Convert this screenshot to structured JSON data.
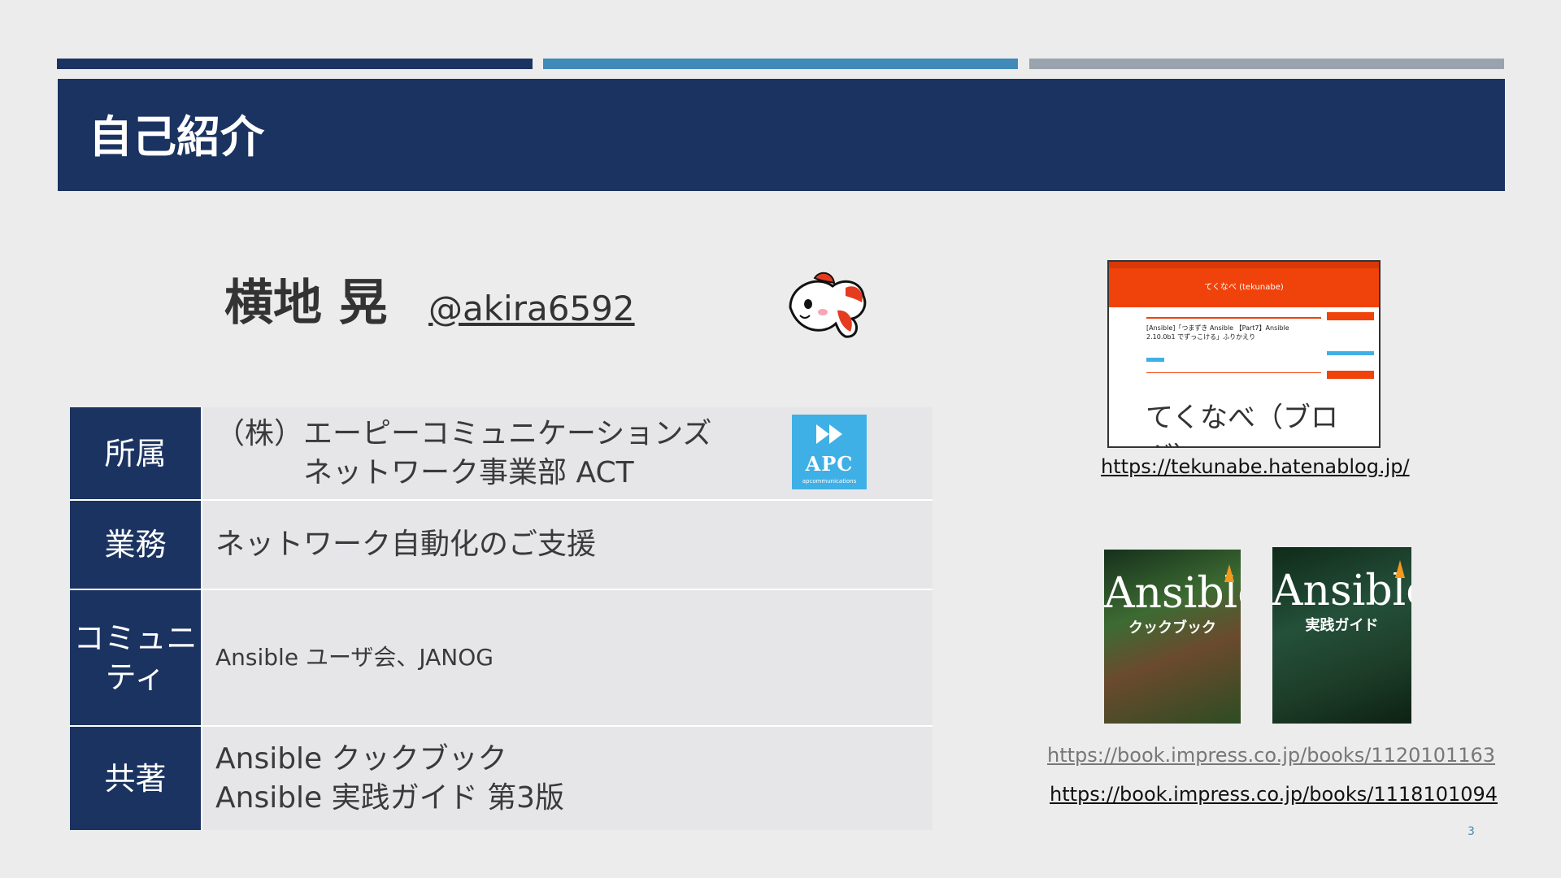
{
  "slide": {
    "title": "自己紹介",
    "page_number": "3"
  },
  "profile": {
    "name": "横地 晃",
    "handle": "@akira6592"
  },
  "table": {
    "rows": [
      {
        "header": "所属",
        "lines": [
          "（株）エーピーコミュニケーションズ",
          "　　　ネットワーク事業部 ACT"
        ]
      },
      {
        "header": "業務",
        "lines": [
          "ネットワーク自動化のご支援"
        ]
      },
      {
        "header": "コミュニティ",
        "header_lines": [
          "コミュニ",
          "ティ"
        ],
        "lines": [
          "Ansible ユーザ会、JANOG"
        ]
      },
      {
        "header": "共著",
        "lines": [
          "Ansible クックブック",
          "Ansible 実践ガイド 第3版"
        ]
      }
    ]
  },
  "apc_logo": {
    "text": "APC",
    "sub": "apcommunications",
    "color": "#3fb0e5"
  },
  "blog": {
    "site": "てくなべ (tekunabe)",
    "post_title": "[Ansible]「つまずき Ansible 【Part7】Ansible 2.10.0b1 でずっこける」ふりかえり",
    "caption": "てくなべ（ブログ）",
    "url": "https://tekunabe.hatenablog.jp/"
  },
  "books": [
    {
      "title": "Ansible",
      "subtitle": "クックブック",
      "url": "https://book.impress.co.jp/books/1120101163"
    },
    {
      "title": "Ansible",
      "subtitle": "実践ガイド",
      "url": "https://book.impress.co.jp/books/1118101094"
    }
  ],
  "colors": {
    "navy": "#1b3361",
    "blue": "#3f8ab8",
    "gray": "#98a3ad",
    "blog_orange": "#f0420b"
  }
}
